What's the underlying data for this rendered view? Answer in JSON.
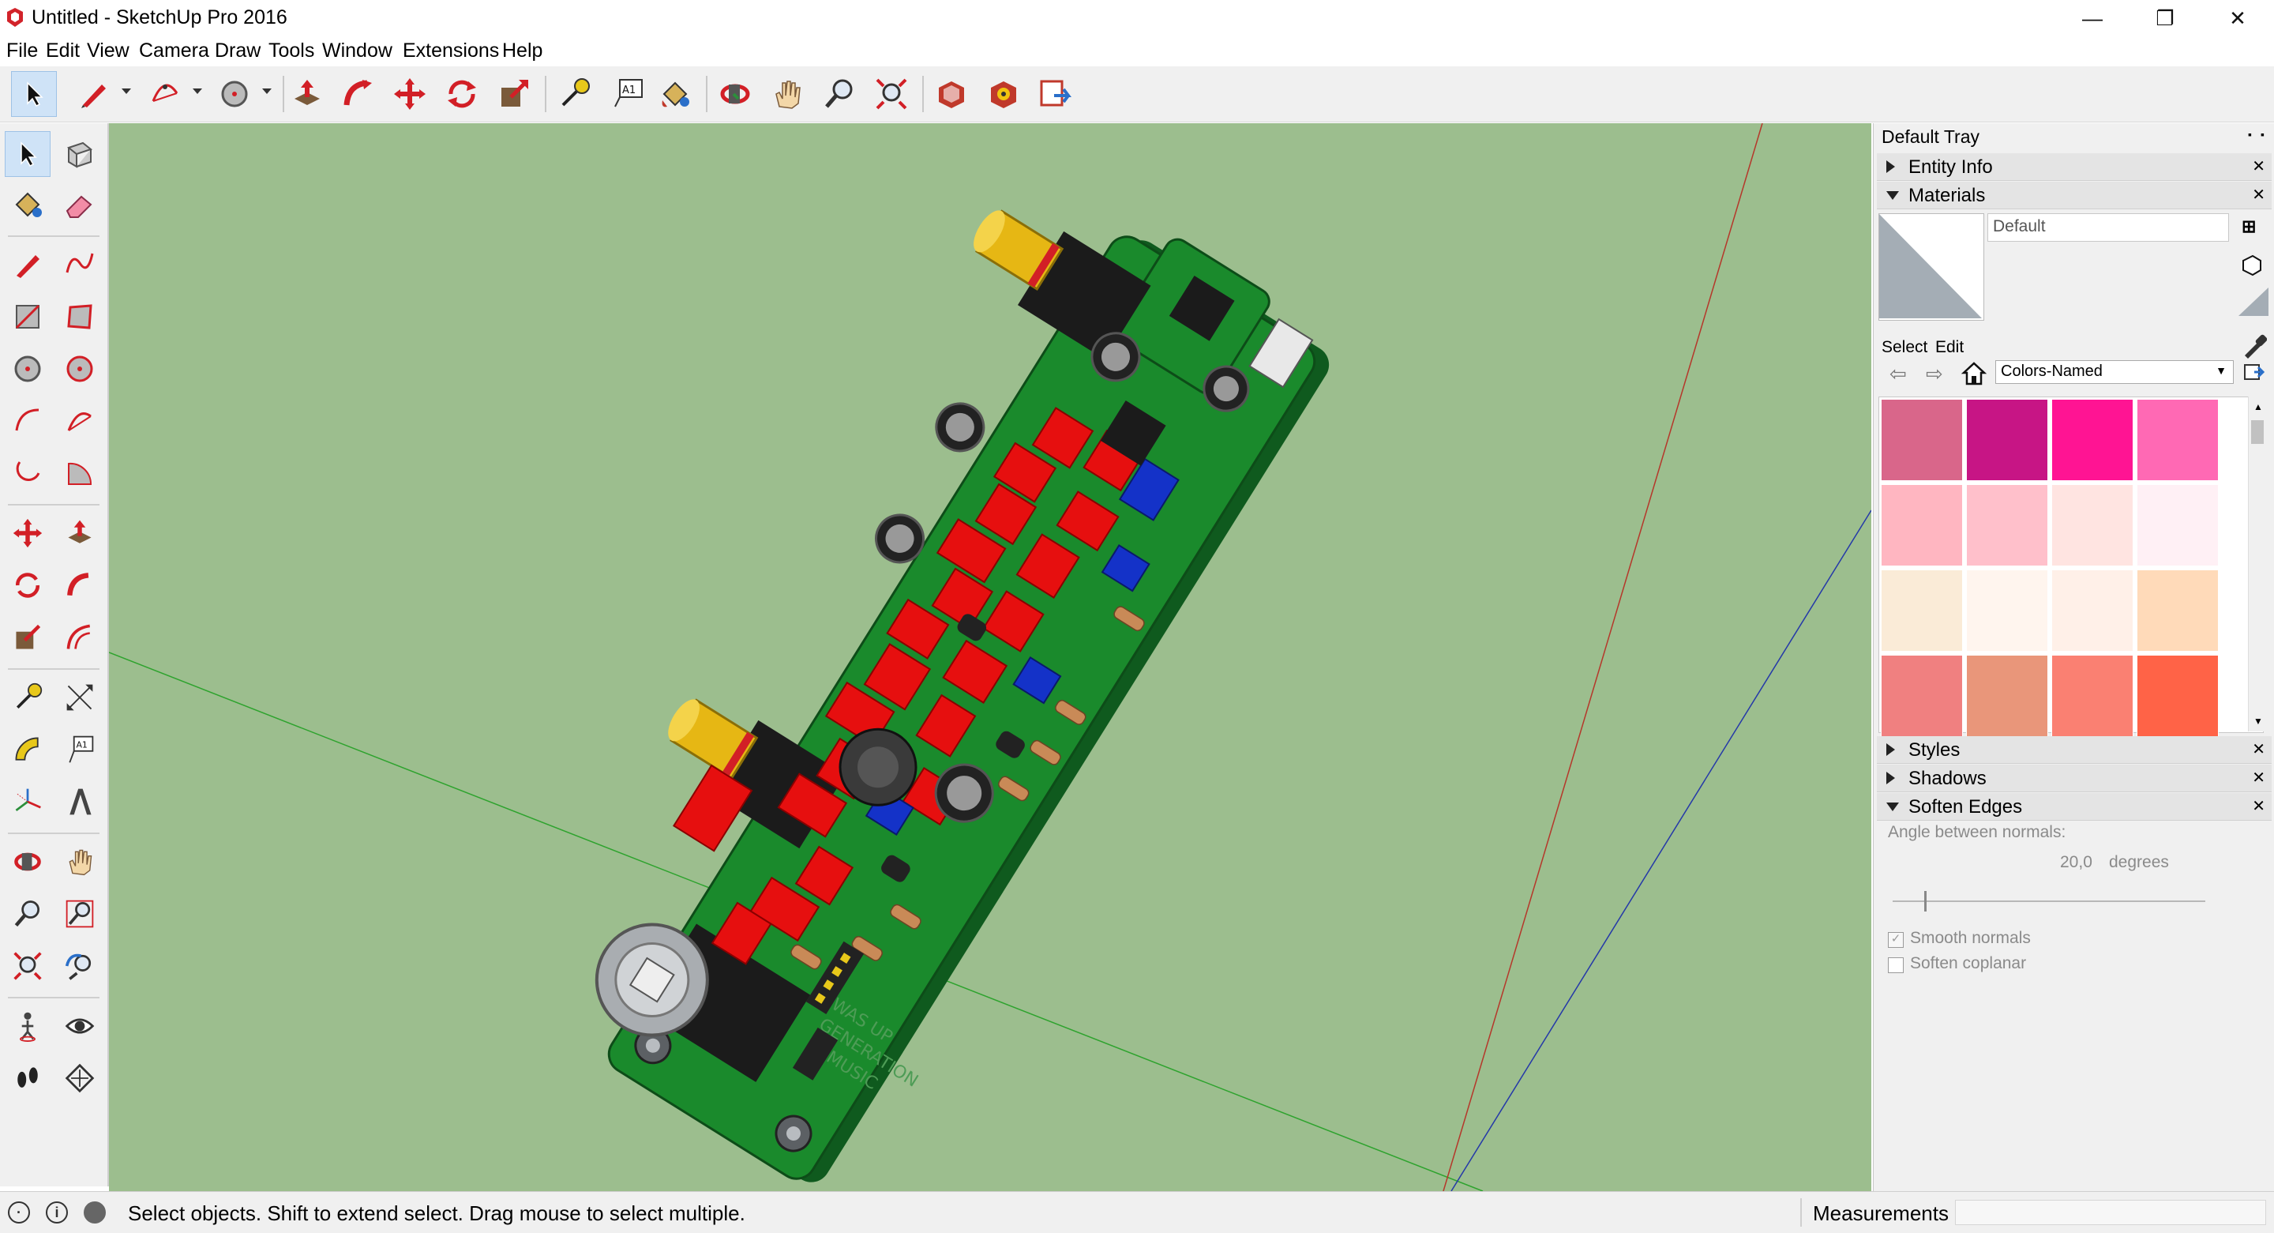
{
  "window": {
    "title": "Untitled - SketchUp Pro 2016",
    "minimize_glyph": "—",
    "restore_glyph": "❐",
    "close_glyph": "✕"
  },
  "menu": [
    "File",
    "Edit",
    "View",
    "Camera",
    "Draw",
    "Tools",
    "Window",
    "Extensions",
    "Help"
  ],
  "toolbar": {
    "tools": [
      "select-icon",
      "line-icon",
      "arc-icon",
      "shapes-icon",
      "push-pull-icon",
      "follow-me-icon",
      "move-icon",
      "rotate-icon",
      "scale-icon",
      "tape-measure-icon",
      "text-icon",
      "paint-bucket-icon",
      "orbit-icon",
      "pan-icon",
      "zoom-icon",
      "zoom-extents-icon",
      "3d-warehouse-icon",
      "extension-warehouse-icon",
      "send-to-layout-icon"
    ]
  },
  "left_tools": {
    "text_tool_label": "A1",
    "dimension_label": "A1"
  },
  "tray": {
    "title": "Default Tray",
    "pin_glyph": "▪",
    "close_glyph": "▪",
    "panels": {
      "entity_info": "Entity Info",
      "materials": "Materials",
      "styles": "Styles",
      "shadows": "Shadows",
      "soften_edges": "Soften Edges"
    },
    "materials": {
      "current_name": "Default",
      "tab_select": "Select",
      "tab_edit": "Edit",
      "library": "Colors-Named",
      "swatch_colors": [
        "#d9668a",
        "#c71585",
        "#ff1493",
        "#ff69b4",
        "#ffb6c1",
        "#ffc0cb",
        "#ffe4e1",
        "#fff0f5",
        "#faebd7",
        "#fff5ee",
        "#fff0e8",
        "#ffdab9",
        "#f08080",
        "#e9967a",
        "#fa8072",
        "#ff6347"
      ]
    },
    "soften": {
      "angle_label": "Angle between normals:",
      "angle_value": "20,0",
      "angle_unit": "degrees",
      "angle_level": 0.1,
      "smooth_normals": "Smooth normals",
      "smooth_checked": true,
      "soften_coplanar": "Soften coplanar",
      "coplanar_checked": false
    }
  },
  "status": {
    "message": "Select objects. Shift to extend select. Drag mouse to select multiple.",
    "measurements_label": "Measurements",
    "info_glyph": "i"
  },
  "pcb": {
    "silkscreen_lines": [
      "MUSIC",
      "GENERATION",
      "WAS UP"
    ]
  }
}
